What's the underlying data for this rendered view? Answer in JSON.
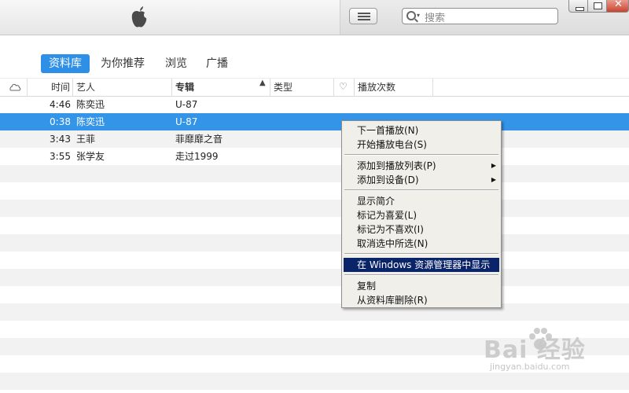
{
  "search": {
    "placeholder": "搜索"
  },
  "tabs": [
    {
      "label": "资料库",
      "active": true
    },
    {
      "label": "为你推荐"
    },
    {
      "label": "浏览"
    },
    {
      "label": "广播"
    }
  ],
  "columns": {
    "time": "时间",
    "artist": "艺人",
    "album": "专辑",
    "genre": "类型",
    "plays": "播放次数"
  },
  "rows": [
    {
      "time": "4:46",
      "artist": "陈奕迅",
      "album": "U-87"
    },
    {
      "time": "0:38",
      "artist": "陈奕迅",
      "album": "U-87",
      "selected": true
    },
    {
      "time": "3:43",
      "artist": "王菲",
      "album": "菲靡靡之音"
    },
    {
      "time": "3:55",
      "artist": "张学友",
      "album": "走过1999"
    }
  ],
  "context_menu": {
    "items": [
      {
        "label": "下一首播放(N)"
      },
      {
        "label": "开始播放电台(S)"
      },
      {
        "label": "添加到播放列表(P)",
        "submenu": true
      },
      {
        "label": "添加到设备(D)",
        "submenu": true
      },
      {
        "label": "显示简介"
      },
      {
        "label": "标记为喜爱(L)"
      },
      {
        "label": "标记为不喜欢(I)"
      },
      {
        "label": "取消选中所选(N)"
      },
      {
        "label": "在 Windows 资源管理器中显示",
        "highlighted": true
      },
      {
        "label": "复制"
      },
      {
        "label": "从资料库删除(R)"
      }
    ]
  },
  "watermark": {
    "brand": "Bai  经验",
    "url": "jingyan.baidu.com"
  },
  "colors": {
    "accent": "#2d8fe6",
    "selection": "#3394e8",
    "menu_highlight": "#0a246a"
  }
}
